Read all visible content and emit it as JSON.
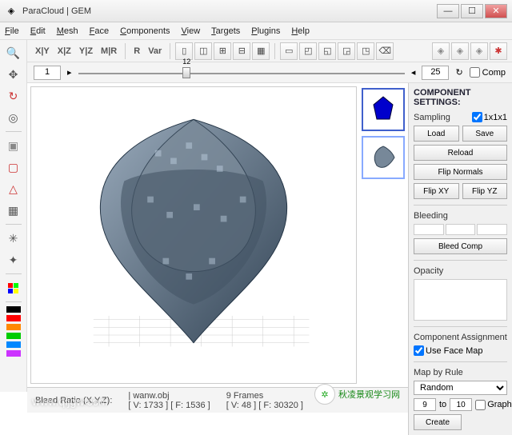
{
  "window": {
    "title": "ParaCloud | GEM"
  },
  "menu": {
    "file": "File",
    "edit": "Edit",
    "mesh": "Mesh",
    "face": "Face",
    "components": "Components",
    "view": "View",
    "targets": "Targets",
    "plugins": "Plugins",
    "help": "Help"
  },
  "toolbar_text": {
    "xy": "X|Y",
    "xz": "X|Z",
    "yz": "Y|Z",
    "mr": "M|R",
    "r": "R",
    "var": "Var"
  },
  "slider": {
    "start": "1",
    "value": "12",
    "end": "25",
    "comp": "Comp"
  },
  "status": {
    "bleed": "Bleed Ratio (X,Y,Z):",
    "file": "| wanw.obj",
    "dims": "[ V: 1733 ] [ F: 1536 ]",
    "frames": "9  Frames",
    "v2": "[ V: 48 ] [ F: 30320 ]"
  },
  "panel": {
    "title": "COMPONENT SETTINGS:",
    "sampling": "Sampling",
    "sampling_val": "1x1x1",
    "load": "Load",
    "save": "Save",
    "reload": "Reload",
    "flip_normals": "Flip Normals",
    "flip_xy": "Flip XY",
    "flip_yz": "Flip YZ",
    "bleeding": "Bleeding",
    "bleed_comp": "Bleed Comp",
    "opacity": "Opacity",
    "comp_assign": "Component Assignment",
    "use_face": "Use Face Map",
    "map_rule": "Map by Rule",
    "rule_val": "Random",
    "from": "9",
    "to_lbl": "to",
    "to": "10",
    "graph": "Graph",
    "create": "Create"
  },
  "watermark": "www.qljgw.com",
  "cornertext": "秋凌景观学习网"
}
